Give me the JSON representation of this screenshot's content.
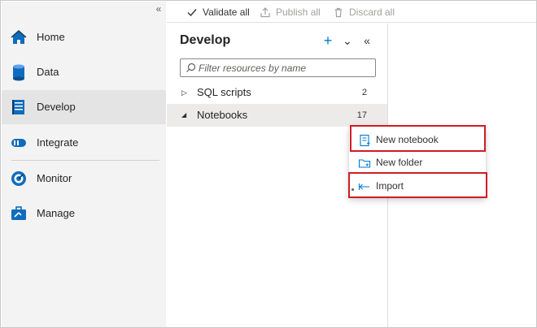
{
  "nav": {
    "collapse_glyph": "«",
    "items": [
      {
        "label": "Home",
        "icon": "home-icon"
      },
      {
        "label": "Data",
        "icon": "database-icon"
      },
      {
        "label": "Develop",
        "icon": "develop-icon"
      },
      {
        "label": "Integrate",
        "icon": "integrate-icon"
      },
      {
        "label": "Monitor",
        "icon": "monitor-icon"
      },
      {
        "label": "Manage",
        "icon": "manage-icon"
      }
    ],
    "selected": "Develop"
  },
  "toolbar": {
    "validate_all": "Validate all",
    "publish_all": "Publish all",
    "discard_all": "Discard all"
  },
  "panel": {
    "title": "Develop",
    "add_glyph": "+",
    "expand_glyph": "⌄",
    "collapse_glyph": "«",
    "search_placeholder": "Filter resources by name",
    "tree": [
      {
        "label": "SQL scripts",
        "count": "2",
        "caret": "▷"
      },
      {
        "label": "Notebooks",
        "count": "17",
        "caret": "◢"
      }
    ]
  },
  "context_menu": {
    "items": [
      {
        "label": "New notebook",
        "icon": "notebook-icon"
      },
      {
        "label": "New folder",
        "icon": "folder-icon"
      },
      {
        "label": "Import",
        "icon": "import-icon"
      }
    ]
  },
  "colors": {
    "accent": "#0078d4",
    "highlight": "#d01c26",
    "nav_bg": "#f3f3f3"
  }
}
